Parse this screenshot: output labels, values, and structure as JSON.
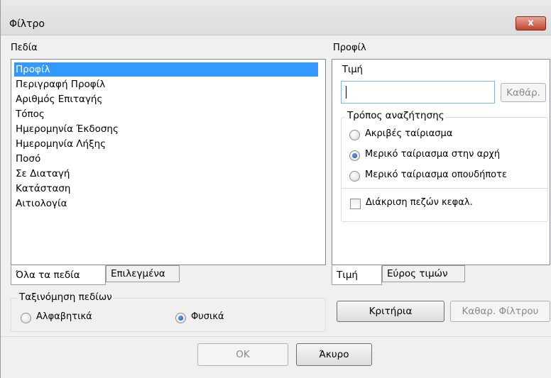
{
  "window": {
    "title": "Φίλτρο",
    "close_glyph": "x"
  },
  "fields_panel": {
    "label": "Πεδία",
    "items": [
      {
        "label": "Προφίλ",
        "selected": true
      },
      {
        "label": "Περιγραφή Προφίλ",
        "selected": false
      },
      {
        "label": "Αριθμός Επιταγής",
        "selected": false
      },
      {
        "label": "Τόπος",
        "selected": false
      },
      {
        "label": "Ημερομηνία Έκδοσης",
        "selected": false
      },
      {
        "label": "Ημερομηνία Λήξης",
        "selected": false
      },
      {
        "label": "Ποσό",
        "selected": false
      },
      {
        "label": "Σε Διαταγή",
        "selected": false
      },
      {
        "label": "Κατάσταση",
        "selected": false
      },
      {
        "label": "Αιτιολογία",
        "selected": false
      }
    ],
    "tabs": [
      {
        "label": "Όλα τα πεδία",
        "active": true
      },
      {
        "label": "Επιλεγμένα",
        "active": false
      }
    ]
  },
  "sort": {
    "legend": "Ταξινόμηση πεδίων",
    "options": [
      {
        "label": "Αλφαβητικά",
        "checked": false
      },
      {
        "label": "Φυσικά",
        "checked": true
      }
    ]
  },
  "profile_panel": {
    "label": "Προφίλ",
    "value_label": "Τιμή",
    "value_input": "",
    "clear_button": "Καθάρ.",
    "search_mode": {
      "legend": "Τρόπος αναζήτησης",
      "options": [
        {
          "label": "Ακριβές ταίριασμα",
          "checked": false
        },
        {
          "label": "Μερικό ταίριασμα στην αρχή",
          "checked": true
        },
        {
          "label": "Μερικό ταίριασμα οπουδήποτε",
          "checked": false
        }
      ]
    },
    "case_sensitive": {
      "label": "Διάκριση πεζών κεφαλ.",
      "checked": false
    },
    "tabs": [
      {
        "label": "Τιμή",
        "active": true
      },
      {
        "label": "Εύρος τιμών",
        "active": false
      }
    ]
  },
  "actions": {
    "criteria_button": "Κριτήρια",
    "clear_filter_button": "Καθαρ. Φίλτρου",
    "ok_button": "OK",
    "cancel_button": "Άκυρο"
  },
  "colors": {
    "selection": "#3399ff",
    "close_button": "#c2452e",
    "focus_border": "#7eb4ea"
  }
}
